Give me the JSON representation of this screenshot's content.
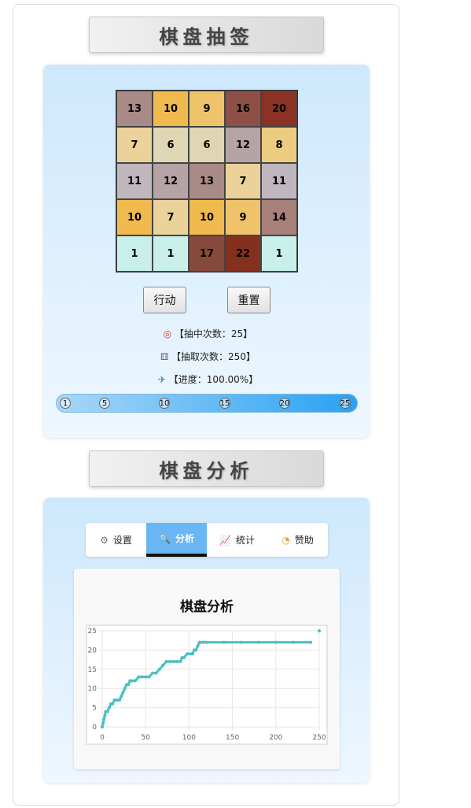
{
  "draw_section": {
    "title": "棋盘抽签",
    "grid": [
      [
        {
          "v": "13",
          "c": "#a88a86"
        },
        {
          "v": "10",
          "c": "#f1ba4e"
        },
        {
          "v": "9",
          "c": "#efc36a"
        },
        {
          "v": "16",
          "c": "#8e5046"
        },
        {
          "v": "20",
          "c": "#8a3224"
        }
      ],
      [
        {
          "v": "7",
          "c": "#ead29a"
        },
        {
          "v": "6",
          "c": "#dfd7b3"
        },
        {
          "v": "6",
          "c": "#dfd7b3"
        },
        {
          "v": "12",
          "c": "#b5a3a5"
        },
        {
          "v": "8",
          "c": "#eccc80"
        }
      ],
      [
        {
          "v": "11",
          "c": "#c0b7be"
        },
        {
          "v": "12",
          "c": "#b5a3a5"
        },
        {
          "v": "13",
          "c": "#a88a86"
        },
        {
          "v": "7",
          "c": "#ead29a"
        },
        {
          "v": "11",
          "c": "#c0b7be"
        }
      ],
      [
        {
          "v": "10",
          "c": "#f1ba4e"
        },
        {
          "v": "7",
          "c": "#ead29a"
        },
        {
          "v": "10",
          "c": "#f1ba4e"
        },
        {
          "v": "9",
          "c": "#efc36a"
        },
        {
          "v": "14",
          "c": "#a8817b"
        }
      ],
      [
        {
          "v": "1",
          "c": "#c8efea"
        },
        {
          "v": "1",
          "c": "#c8efea"
        },
        {
          "v": "17",
          "c": "#864a3c"
        },
        {
          "v": "22",
          "c": "#84301f"
        },
        {
          "v": "1",
          "c": "#c8efea"
        }
      ]
    ],
    "buttons": {
      "action": "行动",
      "reset": "重置"
    },
    "stats": {
      "hits": "【抽中次数：25】",
      "draws": "【抽取次数：250】",
      "progress": "【进度：100.00%】"
    },
    "progress_value": 1.0,
    "milestones": [
      "1",
      "5",
      "10",
      "15",
      "20",
      "25"
    ]
  },
  "analysis_section": {
    "title": "棋盘分析",
    "tabs": [
      {
        "label": "设置",
        "icon": "gear-icon",
        "glyph": "⚙"
      },
      {
        "label": "分析",
        "icon": "magnifier-icon",
        "glyph": "🔍"
      },
      {
        "label": "统计",
        "icon": "chart-icon",
        "glyph": "📈"
      },
      {
        "label": "赞助",
        "icon": "donut-icon",
        "glyph": "◔"
      }
    ],
    "active_tab": 1,
    "card_title": "棋盘分析"
  },
  "colors": {
    "series": "#4bc0c0",
    "accent": "#6ab6f5"
  },
  "chart_data": {
    "type": "scatter",
    "title": "",
    "xlabel": "",
    "ylabel": "",
    "xlim": [
      0,
      250
    ],
    "ylim": [
      0,
      25
    ],
    "xticks": [
      0,
      50,
      100,
      150,
      200,
      250
    ],
    "yticks": [
      0,
      5,
      10,
      15,
      20,
      25
    ],
    "grid": true,
    "series": [
      {
        "name": "",
        "x": [
          0,
          1,
          2,
          3,
          4,
          5,
          6,
          8,
          10,
          12,
          14,
          16,
          18,
          20,
          22,
          24,
          26,
          28,
          30,
          32,
          34,
          38,
          42,
          46,
          50,
          54,
          58,
          62,
          66,
          70,
          74,
          78,
          82,
          86,
          90,
          92,
          94,
          98,
          102,
          104,
          106,
          108,
          110,
          112,
          116,
          120,
          140,
          160,
          180,
          200,
          220,
          240,
          250
        ],
        "y": [
          0,
          1,
          2,
          3,
          4,
          4,
          4,
          5,
          6,
          6,
          7,
          7,
          7,
          7,
          8,
          9,
          10,
          11,
          11,
          12,
          12,
          12,
          13,
          13,
          13,
          13,
          14,
          14,
          15,
          16,
          17,
          17,
          17,
          17,
          17,
          18,
          18,
          19,
          19,
          19,
          20,
          20,
          21,
          22,
          22,
          22,
          22,
          22,
          22,
          22,
          22,
          22,
          25
        ]
      }
    ]
  }
}
